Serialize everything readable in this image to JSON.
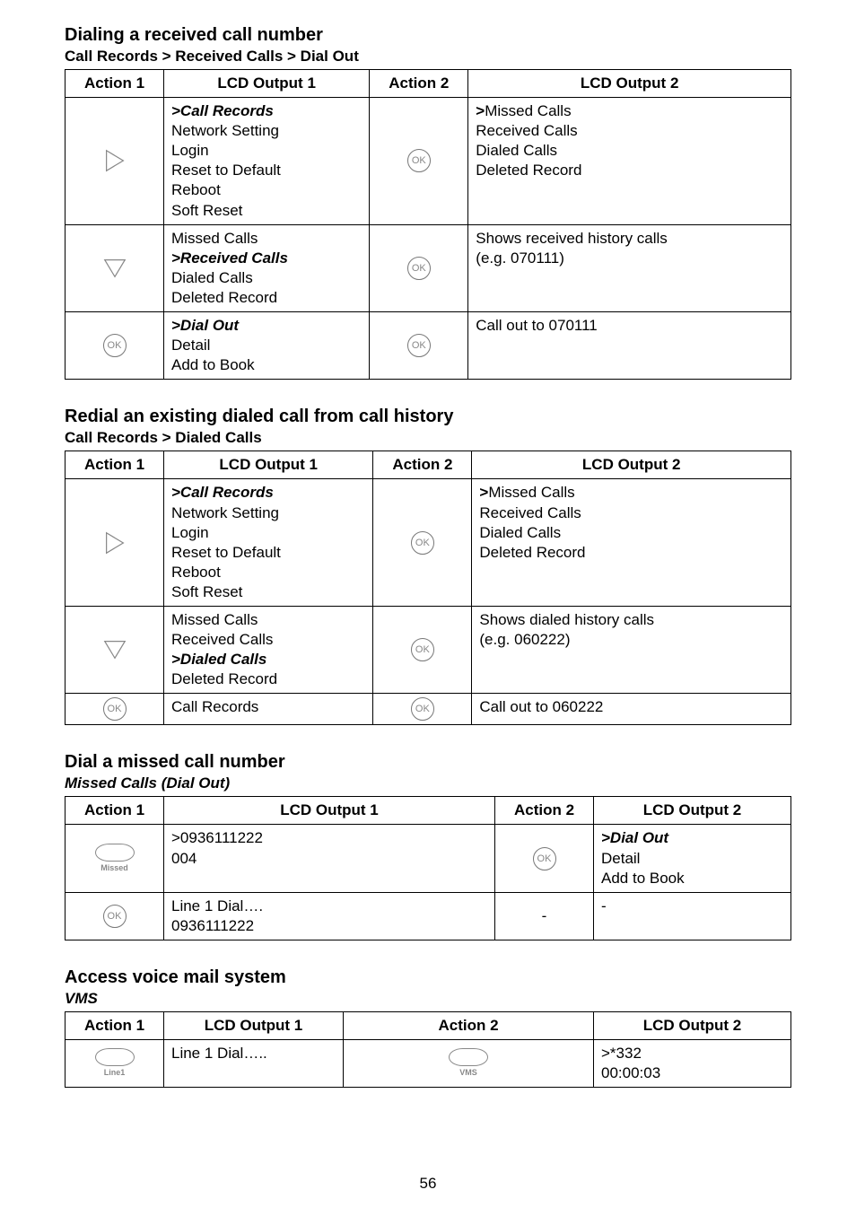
{
  "sec1": {
    "title": "Dialing a received call number",
    "subtitle": "Call Records > Received Calls > Dial Out",
    "headers": {
      "a1": "Action 1",
      "o1": "LCD Output 1",
      "a2": "Action 2",
      "o2": "LCD Output 2"
    },
    "rows": [
      {
        "a1_icon": "triangle-right",
        "o1": {
          "head": ">Call Records",
          "lines": [
            "Network Setting",
            "Login",
            "Reset to Default",
            "Reboot",
            "Soft Reset"
          ]
        },
        "a2_icon": "ok",
        "o2_strong": ">",
        "o2_strong_tail": "Missed Calls",
        "o2_lines": [
          "Received Calls",
          "Dialed Calls",
          "Deleted Record"
        ]
      },
      {
        "a1_icon": "triangle-down",
        "o1": {
          "lines_pre": [
            "Missed Calls"
          ],
          "head": ">Received Calls",
          "lines": [
            "Dialed Calls",
            "Deleted Record"
          ]
        },
        "a2_icon": "ok",
        "o2_lines": [
          "Shows received history calls",
          "(e.g. 070111)"
        ]
      },
      {
        "a1_icon": "ok",
        "o1": {
          "head": ">Dial Out",
          "lines": [
            "Detail",
            "Add to Book"
          ]
        },
        "a2_icon": "ok",
        "o2_lines": [
          "Call out to 070111"
        ]
      }
    ]
  },
  "sec2": {
    "title": "Redial an existing dialed call from call history",
    "subtitle": "Call Records > Dialed Calls",
    "headers": {
      "a1": "Action 1",
      "o1": "LCD Output 1",
      "a2": "Action 2",
      "o2": "LCD Output 2"
    },
    "rows": [
      {
        "a1_icon": "triangle-right",
        "o1": {
          "head": ">Call Records",
          "lines": [
            "Network Setting",
            "Login",
            "Reset to Default",
            "Reboot",
            "Soft Reset"
          ]
        },
        "a2_icon": "ok",
        "o2_strong": ">",
        "o2_strong_tail": "Missed Calls",
        "o2_lines": [
          "Received Calls",
          "Dialed Calls",
          "Deleted Record"
        ]
      },
      {
        "a1_icon": "triangle-down",
        "o1": {
          "lines_pre": [
            "Missed Calls",
            "Received Calls"
          ],
          "head": ">Dialed Calls",
          "lines": [
            "Deleted Record"
          ]
        },
        "a2_icon": "ok",
        "o2_lines": [
          "Shows dialed history calls",
          "(e.g. 060222)"
        ]
      },
      {
        "a1_icon": "ok",
        "o1": {
          "lines_pre": [
            "Call Records"
          ]
        },
        "a2_icon": "ok",
        "o2_lines": [
          "Call out to 060222"
        ]
      }
    ]
  },
  "sec3": {
    "title": "Dial a missed call number",
    "subtitle": "Missed Calls (Dial Out)",
    "headers": {
      "a1": "Action 1",
      "o1": "LCD Output 1",
      "a2": "Action 2",
      "o2": "LCD Output 2"
    },
    "rows": [
      {
        "a1_key_label": "Missed",
        "o1_lines": [
          ">0936111222",
          "004"
        ],
        "a2_icon": "ok",
        "o2": {
          "head": ">Dial Out",
          "lines": [
            "Detail",
            "Add to Book"
          ]
        }
      },
      {
        "a1_icon": "ok",
        "o1_lines": [
          "Line 1 Dial….",
          "0936111222"
        ],
        "a2_text": "-",
        "o2_text": "-"
      }
    ]
  },
  "sec4": {
    "title": "Access voice mail system",
    "subtitle": "VMS",
    "headers": {
      "a1": "Action 1",
      "o1": "LCD Output 1",
      "a2": "Action 2",
      "o2": "LCD Output 2"
    },
    "rows": [
      {
        "a1_key_label": "Line1",
        "o1_text": "Line 1 Dial…..",
        "a2_key_label": "VMS",
        "o2_lines": [
          ">*332",
          "00:00:03"
        ]
      }
    ]
  },
  "page_number": "56"
}
